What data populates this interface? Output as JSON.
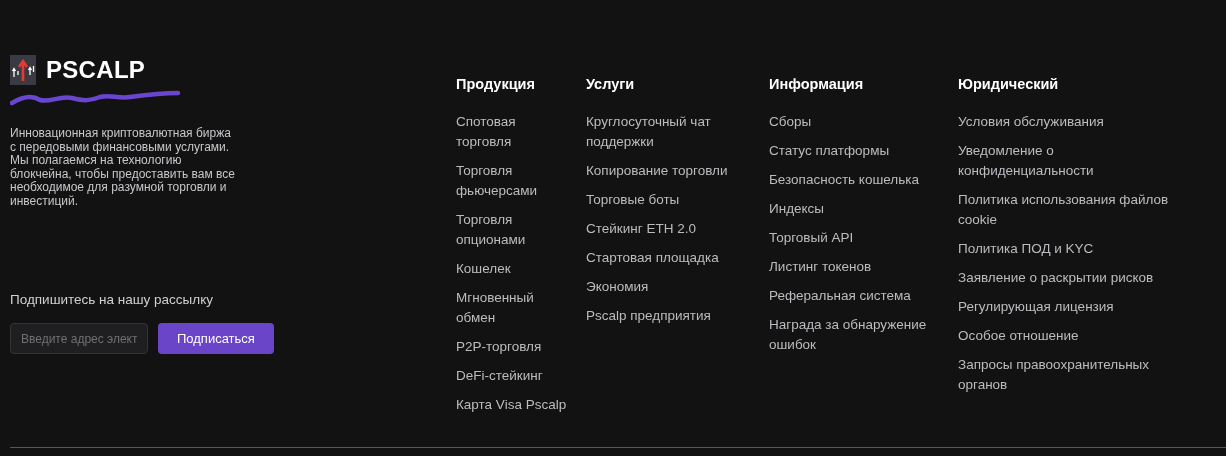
{
  "brand": {
    "name": "PSCALP",
    "description": "Инновационная криптовалютная биржа\nс передовыми финансовыми услугами.\nМы полагаемся на технологию\nблокчейна, чтобы предоставить вам все\nнеобходимое для разумной торговли и\nинвестиций."
  },
  "newsletter": {
    "label": "Подпишитесь на нашу рассылку",
    "placeholder": "Введите адрес элект",
    "button": "Подписаться"
  },
  "columns": [
    {
      "title": "Продукция",
      "links": [
        "Спотовая\nторговля",
        "Торговля\nфьючерсами",
        "Торговля\nопционами",
        "Кошелек",
        "Мгновенный\nобмен",
        "P2P-торговля",
        "DeFi-стейкинг",
        "Карта Visa Pscalp"
      ]
    },
    {
      "title": "Услуги",
      "links": [
        "Круглосуточный чат\nподдержки",
        "Копирование торговли",
        "Торговые боты",
        "Стейкинг ETH 2.0",
        "Стартовая площадка",
        "Экономия",
        "Pscalp предприятия"
      ]
    },
    {
      "title": "Информация",
      "links": [
        "Сборы",
        "Статус платформы",
        "Безопасность кошелька",
        "Индексы",
        "Торговый API",
        "Листинг токенов",
        "Реферальная система",
        "Награда за обнаружение\nошибок"
      ]
    },
    {
      "title": "Юридический",
      "links": [
        "Условия обслуживания",
        "Уведомление о\nконфиденциальности",
        "Политика использования файлов\ncookie",
        "Политика ПОД и KYC",
        "Заявление о раскрытии рисков",
        "Регулирующая лицензия",
        "Особое отношение",
        "Запросы правоохранительных\nорганов"
      ]
    }
  ]
}
